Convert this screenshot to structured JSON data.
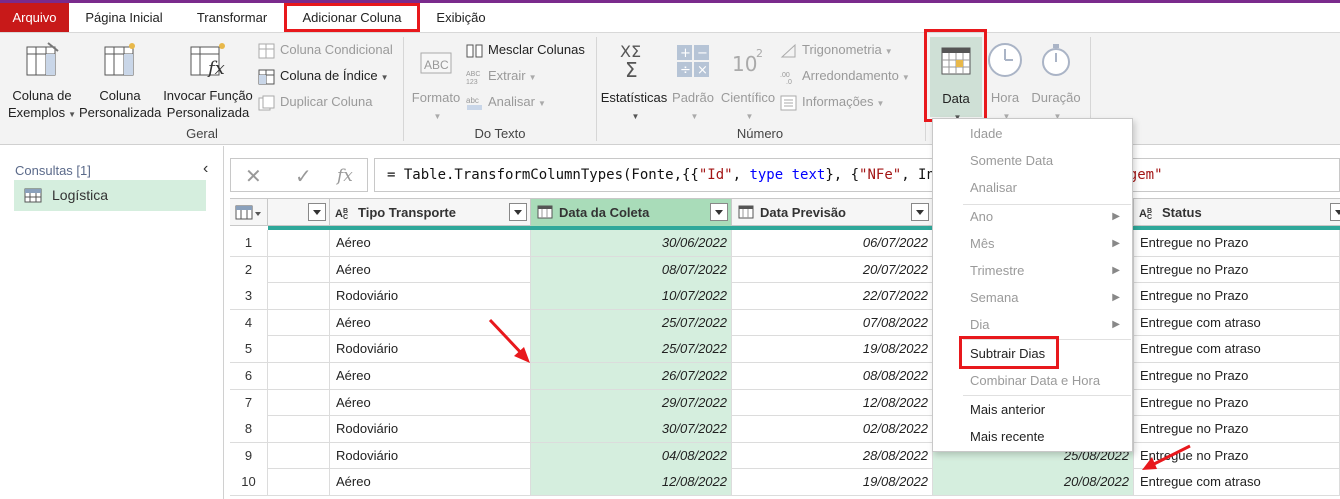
{
  "accent_color": "#e8181c",
  "tabs": [
    "Arquivo",
    "Página Inicial",
    "Transformar",
    "Adicionar Coluna",
    "Exibição"
  ],
  "ribbon": {
    "geral": {
      "label": "Geral",
      "col_exemplos": [
        "Coluna de",
        "Exemplos"
      ],
      "col_personalizada": [
        "Coluna",
        "Personalizada"
      ],
      "invocar_funcao": [
        "Invocar Função",
        "Personalizada"
      ],
      "col_condicional": "Coluna Condicional",
      "col_indice": "Coluna de Índice",
      "duplicar_coluna": "Duplicar Coluna"
    },
    "texto": {
      "label": "Do Texto",
      "formato": "Formato",
      "mesclar": "Mesclar Colunas",
      "extrair": "Extrair",
      "analisar": "Analisar"
    },
    "numero": {
      "label": "Número",
      "estatisticas": "Estatísticas",
      "padrao": "Padrão",
      "cientifico": "Científico",
      "trigonometria": "Trigonometria",
      "arredondamento": "Arredondamento",
      "informacoes": "Informações"
    },
    "data_hora": {
      "data": "Data",
      "hora": "Hora",
      "duracao": "Duração"
    }
  },
  "queries": {
    "title": "Consultas [1]",
    "items": [
      "Logística"
    ]
  },
  "formula": "= Table.TransformColumnTypes(Fonte,{{\"Id\", type text}, {\"NFe\", Int64.Type}, {\"Cidade Origem\"",
  "formula_visible_tail": "Int64.Type}, {\"Cidade Ori",
  "columns": [
    "",
    "Tipo Transporte",
    "Data da Coleta",
    "Data Previsão",
    "",
    "Status"
  ],
  "rows": [
    {
      "n": "1",
      "tipo": "Aéreo",
      "coleta": "30/06/2022",
      "previsao": "06/07/2022",
      "entrega": "",
      "status": "Entregue no Prazo"
    },
    {
      "n": "2",
      "tipo": "Aéreo",
      "coleta": "08/07/2022",
      "previsao": "20/07/2022",
      "entrega": "",
      "status": "Entregue no Prazo"
    },
    {
      "n": "3",
      "tipo": "Rodoviário",
      "coleta": "10/07/2022",
      "previsao": "22/07/2022",
      "entrega": "",
      "status": "Entregue no Prazo"
    },
    {
      "n": "4",
      "tipo": "Aéreo",
      "coleta": "25/07/2022",
      "previsao": "07/08/2022",
      "entrega": "",
      "status": "Entregue com atraso"
    },
    {
      "n": "5",
      "tipo": "Rodoviário",
      "coleta": "25/07/2022",
      "previsao": "19/08/2022",
      "entrega": "",
      "status": "Entregue com atraso"
    },
    {
      "n": "6",
      "tipo": "Aéreo",
      "coleta": "26/07/2022",
      "previsao": "08/08/2022",
      "entrega": "",
      "status": "Entregue no Prazo"
    },
    {
      "n": "7",
      "tipo": "Aéreo",
      "coleta": "29/07/2022",
      "previsao": "12/08/2022",
      "entrega": "",
      "status": "Entregue no Prazo"
    },
    {
      "n": "8",
      "tipo": "Rodoviário",
      "coleta": "30/07/2022",
      "previsao": "02/08/2022",
      "entrega": "",
      "status": "Entregue no Prazo"
    },
    {
      "n": "9",
      "tipo": "Rodoviário",
      "coleta": "04/08/2022",
      "previsao": "28/08/2022",
      "entrega": "25/08/2022",
      "status": "Entregue no Prazo"
    },
    {
      "n": "10",
      "tipo": "Aéreo",
      "coleta": "12/08/2022",
      "previsao": "19/08/2022",
      "entrega": "20/08/2022",
      "status": "Entregue com atraso"
    }
  ],
  "menu": {
    "idade": "Idade",
    "somente_data": "Somente Data",
    "analisar": "Analisar",
    "ano": "Ano",
    "mes": "Mês",
    "trimestre": "Trimestre",
    "semana": "Semana",
    "dia": "Dia",
    "subtrair_dias": "Subtrair Dias",
    "combinar": "Combinar Data e Hora",
    "mais_anterior": "Mais anterior",
    "mais_recente": "Mais recente"
  }
}
